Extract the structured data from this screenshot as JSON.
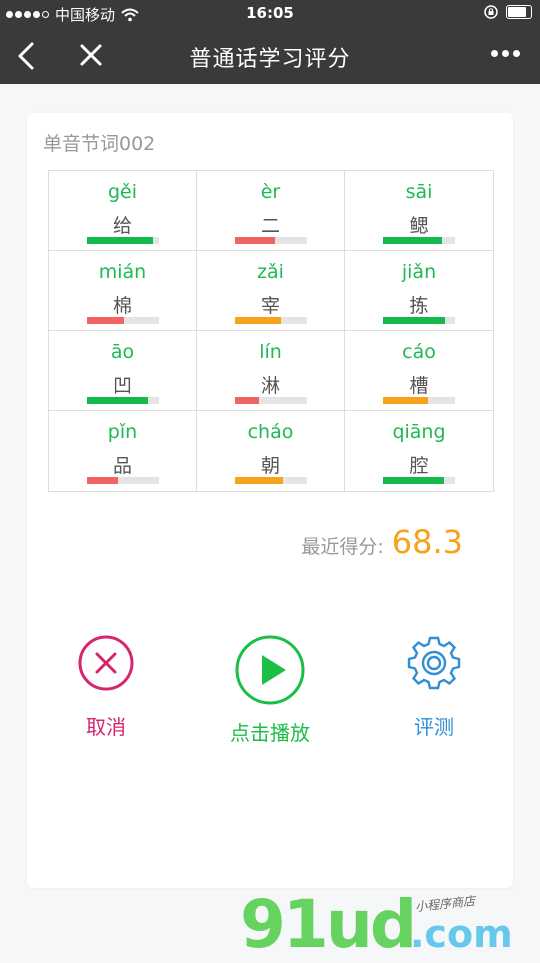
{
  "status_bar": {
    "carrier": "中国移动",
    "time": "16:05"
  },
  "title_bar": {
    "title": "普通话学习评分"
  },
  "card": {
    "title": "单音节词002"
  },
  "words": [
    {
      "pinyin": "gěi",
      "hanzi": "给",
      "score": 0.92,
      "color": "#14b84b"
    },
    {
      "pinyin": "èr",
      "hanzi": "二",
      "score": 0.55,
      "color": "#f26363"
    },
    {
      "pinyin": "sāi",
      "hanzi": "鳃",
      "score": 0.82,
      "color": "#14b84b"
    },
    {
      "pinyin": "mián",
      "hanzi": "棉",
      "score": 0.52,
      "color": "#f26363"
    },
    {
      "pinyin": "zǎi",
      "hanzi": "宰",
      "score": 0.64,
      "color": "#f7a21b"
    },
    {
      "pinyin": "jiǎn",
      "hanzi": "拣",
      "score": 0.86,
      "color": "#14b84b"
    },
    {
      "pinyin": "āo",
      "hanzi": "凹",
      "score": 0.85,
      "color": "#14b84b"
    },
    {
      "pinyin": "lín",
      "hanzi": "淋",
      "score": 0.33,
      "color": "#f26363"
    },
    {
      "pinyin": "cáo",
      "hanzi": "槽",
      "score": 0.62,
      "color": "#f7a21b"
    },
    {
      "pinyin": "pǐn",
      "hanzi": "品",
      "score": 0.43,
      "color": "#f26363"
    },
    {
      "pinyin": "cháo",
      "hanzi": "朝",
      "score": 0.67,
      "color": "#f7a21b"
    },
    {
      "pinyin": "qiāng",
      "hanzi": "腔",
      "score": 0.85,
      "color": "#14b84b"
    }
  ],
  "score": {
    "label": "最近得分:",
    "value": "68.3"
  },
  "actions": {
    "cancel": {
      "label": "取消",
      "icon": "cancel-icon",
      "color": "#d6256f"
    },
    "play": {
      "label": "点击播放",
      "icon": "play-icon",
      "color": "#1bbf45"
    },
    "evaluate": {
      "label": "评测",
      "icon": "gear-icon",
      "color": "#2f8fd6"
    }
  },
  "watermark": {
    "text": "91ud",
    "domain": ".com",
    "sub": "小程序商店"
  }
}
